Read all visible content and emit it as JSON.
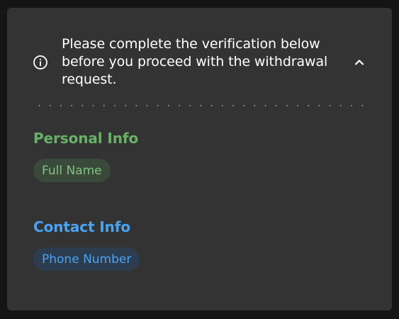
{
  "notice": {
    "text": "Please complete the verification below before you proceed with the withdrawal request.",
    "icon": "info-icon",
    "toggle_icon": "chevron-up-icon"
  },
  "sections": [
    {
      "title": "Personal Info",
      "color": "#68b168",
      "fields": [
        {
          "label": "Full Name"
        }
      ]
    },
    {
      "title": "Contact Info",
      "color": "#4aa3f2",
      "fields": [
        {
          "label": "Phone Number"
        }
      ]
    }
  ],
  "colors": {
    "background": "#151515",
    "panel": "#333333",
    "text": "#ffffff"
  }
}
